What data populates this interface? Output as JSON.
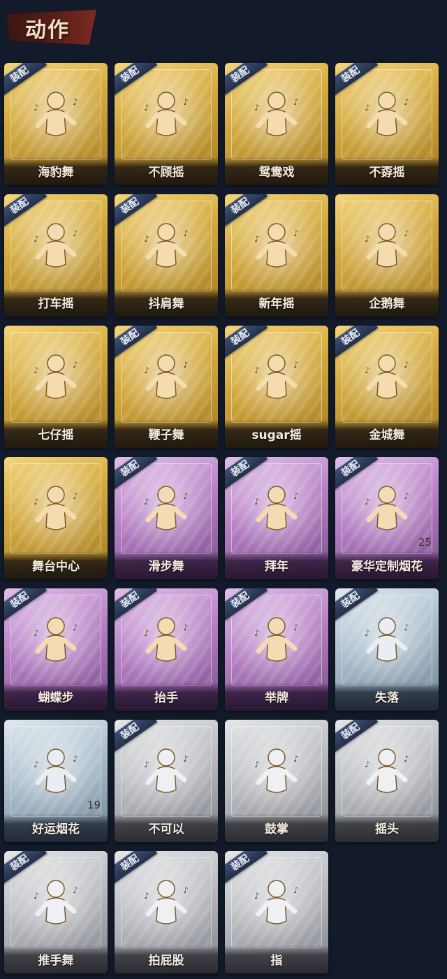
{
  "header": {
    "title": "动作"
  },
  "badge_label": "装配",
  "colors": {
    "gold": "#d4aa3f",
    "purple": "#b57fc4",
    "blue": "#a9bccb",
    "gray": "#b9bbc0",
    "badge": "#2f3d5c"
  },
  "items": [
    {
      "label": "海豹舞",
      "tier": "gold",
      "equipped": true,
      "icon": "dance-figure-icon"
    },
    {
      "label": "不顾摇",
      "tier": "gold",
      "equipped": true,
      "icon": "dance-figure-icon"
    },
    {
      "label": "鸳鸯戏",
      "tier": "gold",
      "equipped": true,
      "icon": "dance-figure-icon"
    },
    {
      "label": "不孬摇",
      "tier": "gold",
      "equipped": true,
      "icon": "dance-figure-icon"
    },
    {
      "label": "打车摇",
      "tier": "gold",
      "equipped": true,
      "icon": "dance-figure-icon"
    },
    {
      "label": "抖肩舞",
      "tier": "gold",
      "equipped": true,
      "icon": "dance-figure-icon"
    },
    {
      "label": "新年摇",
      "tier": "gold",
      "equipped": true,
      "icon": "dance-figure-icon"
    },
    {
      "label": "企鹅舞",
      "tier": "gold",
      "equipped": false,
      "icon": "dance-figure-icon"
    },
    {
      "label": "七仔摇",
      "tier": "gold",
      "equipped": false,
      "icon": "dance-figure-icon"
    },
    {
      "label": "鞭子舞",
      "tier": "gold",
      "equipped": true,
      "icon": "dance-figure-icon"
    },
    {
      "label": "sugar摇",
      "tier": "gold",
      "equipped": true,
      "icon": "dance-figure-icon"
    },
    {
      "label": "金城舞",
      "tier": "gold",
      "equipped": true,
      "icon": "dance-figure-icon"
    },
    {
      "label": "舞台中心",
      "tier": "gold",
      "equipped": false,
      "icon": "dance-figure-icon"
    },
    {
      "label": "滑步舞",
      "tier": "purple",
      "equipped": true,
      "icon": "dance-figure-icon"
    },
    {
      "label": "拜年",
      "tier": "purple",
      "equipped": true,
      "icon": "bow-figure-icon"
    },
    {
      "label": "豪华定制烟花",
      "tier": "purple",
      "equipped": true,
      "icon": "fireworks-icon",
      "count": "25"
    },
    {
      "label": "蝴蝶步",
      "tier": "purple",
      "equipped": true,
      "icon": "dance-figure-icon"
    },
    {
      "label": "抬手",
      "tier": "purple",
      "equipped": true,
      "icon": "raise-hand-icon"
    },
    {
      "label": "举牌",
      "tier": "purple",
      "equipped": true,
      "icon": "sign-holder-icon"
    },
    {
      "label": "失落",
      "tier": "blue",
      "equipped": true,
      "icon": "crawling-figure-icon"
    },
    {
      "label": "好运烟花",
      "tier": "blue",
      "equipped": false,
      "icon": "firecracker-icon",
      "count": "19"
    },
    {
      "label": "不可以",
      "tier": "gray",
      "equipped": true,
      "icon": "pointing-finger-icon"
    },
    {
      "label": "鼓掌",
      "tier": "gray",
      "equipped": false,
      "icon": "clapping-hands-icon"
    },
    {
      "label": "摇头",
      "tier": "gray",
      "equipped": true,
      "icon": "shake-head-icon"
    },
    {
      "label": "推手舞",
      "tier": "gray",
      "equipped": true,
      "icon": "push-hands-icon"
    },
    {
      "label": "拍屁股",
      "tier": "gray",
      "equipped": true,
      "icon": "dance-figure-icon"
    },
    {
      "label": "指",
      "tier": "gray",
      "equipped": true,
      "icon": "pointing-hand-icon"
    }
  ]
}
